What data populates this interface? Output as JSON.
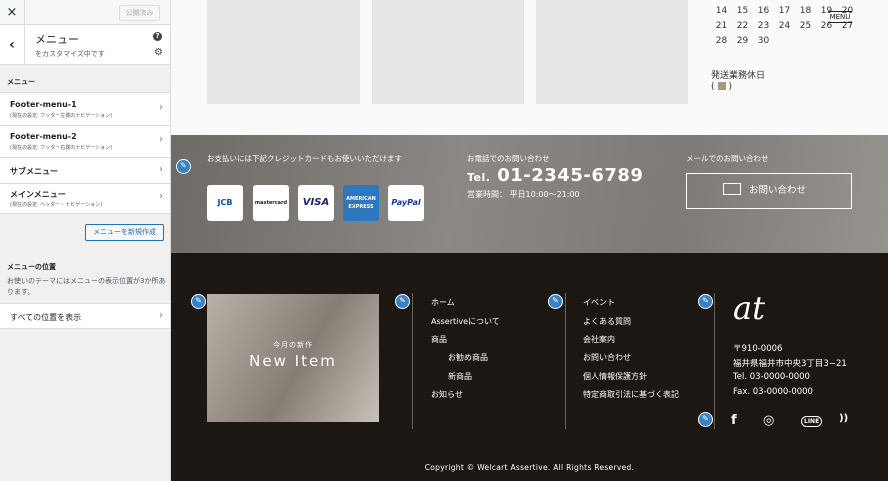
{
  "customizer": {
    "close_icon": "×",
    "publish_label": "公開済み",
    "back_icon": "‹",
    "section_title": "メニュー",
    "section_subtitle": "をカスタマイズ中です",
    "help_icon": "?",
    "gear_icon": "⚙",
    "menus_heading": "メニュー",
    "menus": [
      {
        "title": "Footer-menu-1",
        "desc": "(現在の設定: フッター左側のナビゲーション)"
      },
      {
        "title": "Footer-menu-2",
        "desc": "(現在の設定: フッター右側のナビゲーション)"
      },
      {
        "title": "サブメニュー",
        "desc": ""
      },
      {
        "title": "メインメニュー",
        "desc": "(現在の設定: ヘッダー・ナビゲーション)"
      }
    ],
    "new_menu_button": "メニューを新規作成",
    "locations_heading": "メニューの位置",
    "locations_desc": "お使いのテーマにはメニューの表示位置が3か所あります。",
    "view_all_locations": "すべての位置を表示",
    "chevron": "›"
  },
  "preview": {
    "calendar": {
      "rows": [
        [
          "14",
          "15",
          "16",
          "17",
          "18",
          "19",
          "20"
        ],
        [
          "21",
          "22",
          "23",
          "24",
          "25",
          "26",
          "27"
        ],
        [
          "28",
          "29",
          "30"
        ]
      ],
      "menu_label": "MENU",
      "holiday_label": "発送業務休日",
      "holiday_legend_open": "(",
      "holiday_legend_close": ")"
    },
    "contact": {
      "payment_label": "お支払いには下記クレジットカードもお使いいただけます",
      "cards": [
        "JCB",
        "mastercard",
        "VISA",
        "AMERICAN EXPRESS",
        "PayPal"
      ],
      "phone_label": "お電話でのお問い合わせ",
      "phone_prefix": "Tel.",
      "phone_number": "01-2345-6789",
      "phone_hours": "営業時間： 平日10:00～21:00",
      "mail_label": "メールでのお問い合わせ",
      "mail_button": "お問い合わせ"
    },
    "footer": {
      "banner_sub": "今月の新作",
      "banner_main": "New Item",
      "nav1": [
        "ホーム",
        "Assertiveについて",
        "商品",
        "お勧め商品",
        "新商品",
        "お知らせ"
      ],
      "nav2": [
        "イベント",
        "よくある質問",
        "会社案内",
        "お問い合わせ",
        "個人情報保護方針",
        "特定商取引法に基づく表記"
      ],
      "logo": "at",
      "postal": "〒910-0006",
      "address": "福井県福井市中央3丁目3−21",
      "tel": "Tel. 03-0000-0000",
      "fax": "Fax. 03-0000-0000",
      "social": [
        "f",
        "◎",
        "LINE",
        "))"
      ],
      "copyright": "Copyright © Welcart Assertive. All Rights Reserved."
    },
    "edit_icon": "✎"
  },
  "colors": {
    "accent_blue": "#2271b1",
    "pencil_blue": "#3582c4",
    "footer_bg": "#1d1713"
  }
}
